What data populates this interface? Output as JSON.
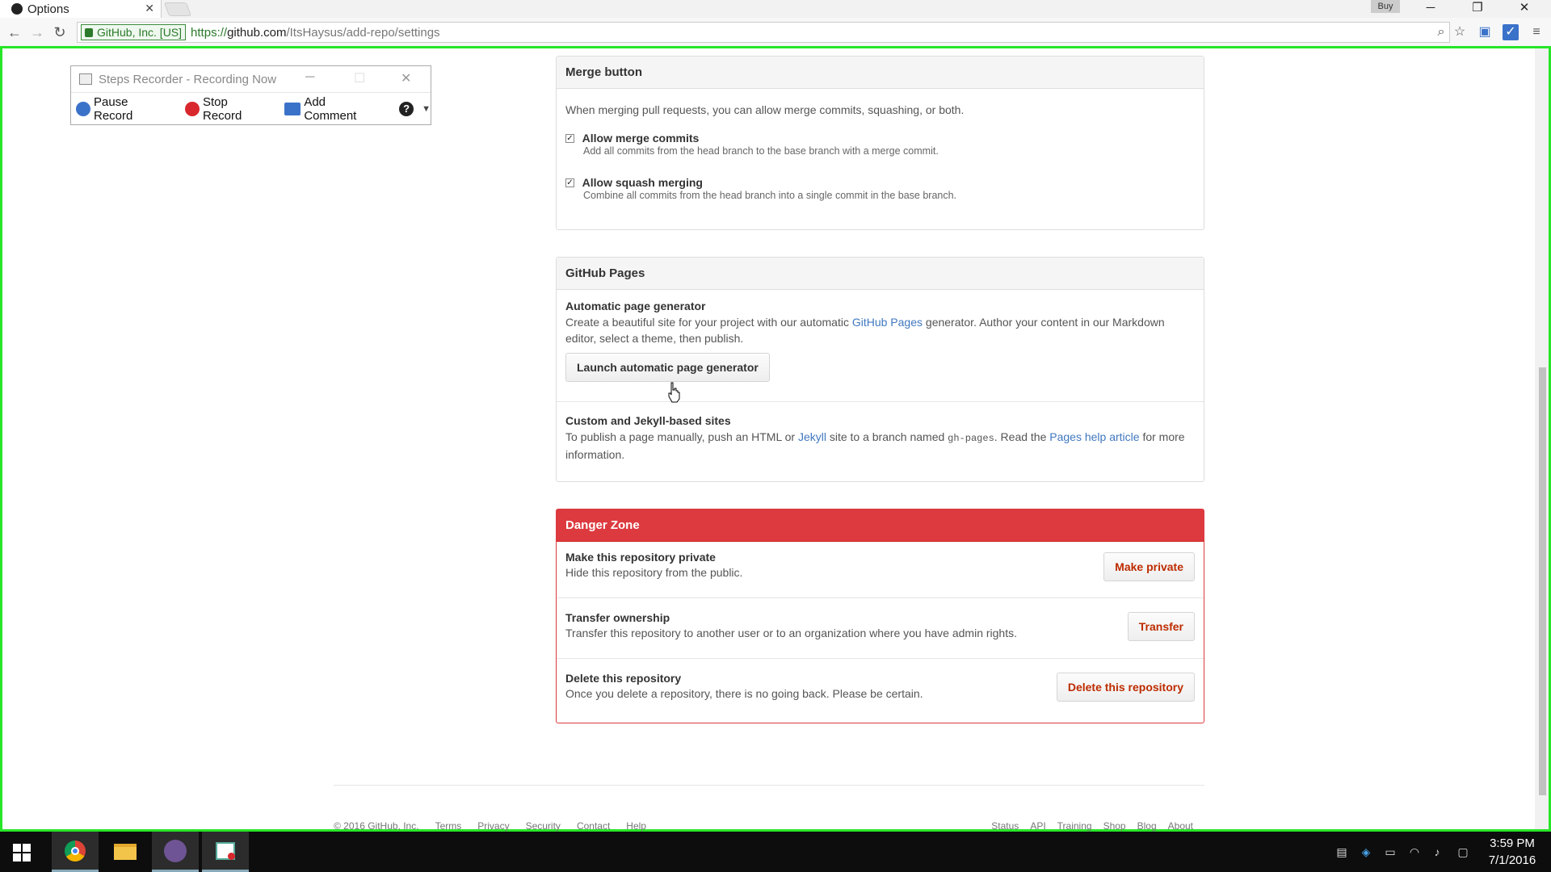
{
  "browser": {
    "tab_title": "Options",
    "tab_close": "✕",
    "buy_label": "Buy",
    "secure_label": "GitHub, Inc. [US]",
    "url_scheme": "https://",
    "url_host": "github.com",
    "url_path": "/ItsHaysus/add-repo/settings"
  },
  "recorder": {
    "title": "Steps Recorder - Recording Now",
    "pause_label": "Pause Record",
    "stop_label": "Stop Record",
    "comment_label": "Add Comment",
    "help_label": "?"
  },
  "merge": {
    "title": "Merge button",
    "intro": "When merging pull requests, you can allow merge commits, squashing, or both.",
    "option1_label": "Allow merge commits",
    "option1_desc": "Add all commits from the head branch to the base branch with a merge commit.",
    "option1_checked": true,
    "option2_label": "Allow squash merging",
    "option2_desc": "Combine all commits from the head branch into a single commit in the base branch.",
    "option2_checked": true
  },
  "pages": {
    "title": "GitHub Pages",
    "auto_heading": "Automatic page generator",
    "auto_text_1": "Create a beautiful site for your project with our automatic ",
    "auto_link": "GitHub Pages",
    "auto_text_2": " generator. Author your content in our Markdown editor, select a theme, then publish.",
    "launch_button": "Launch automatic page generator",
    "custom_heading": "Custom and Jekyll-based sites",
    "custom_text_1": "To publish a page manually, push an HTML or ",
    "custom_link_jekyll": "Jekyll",
    "custom_text_2": " site to a branch named ",
    "custom_branch": "gh-pages",
    "custom_text_3": ". Read the ",
    "custom_link_help": "Pages help article",
    "custom_text_4": " for more information."
  },
  "danger": {
    "title": "Danger Zone",
    "private_heading": "Make this repository private",
    "private_desc": "Hide this repository from the public.",
    "private_button": "Make private",
    "transfer_heading": "Transfer ownership",
    "transfer_desc": "Transfer this repository to another user or to an organization where you have admin rights.",
    "transfer_button": "Transfer",
    "delete_heading": "Delete this repository",
    "delete_desc": "Once you delete a repository, there is no going back. Please be certain.",
    "delete_button": "Delete this repository"
  },
  "footer": {
    "left": [
      "© 2016 GitHub, Inc.",
      "Terms",
      "Privacy",
      "Security",
      "Contact",
      "Help"
    ],
    "right": [
      "Status",
      "API",
      "Training",
      "Shop",
      "Blog",
      "About"
    ]
  },
  "taskbar": {
    "time": "3:59 PM",
    "date": "7/1/2016"
  },
  "colors": {
    "frame_highlight": "#27e527",
    "danger": "#dc3a3f",
    "link": "#4078c0"
  }
}
